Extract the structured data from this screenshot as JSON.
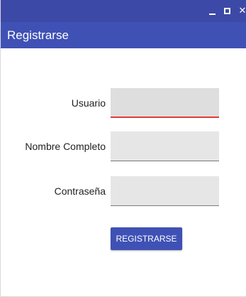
{
  "window": {
    "minimize_icon": "minimize-icon",
    "maximize_icon": "maximize-icon",
    "close_icon": "close-icon",
    "close_glyph": "✕"
  },
  "appbar": {
    "title": "Registrarse"
  },
  "form": {
    "username": {
      "label": "Usuario",
      "value": ""
    },
    "fullname": {
      "label": "Nombre Completo",
      "value": ""
    },
    "password": {
      "label": "Contraseña",
      "value": ""
    },
    "submit_label": "REGISTRARSE"
  },
  "colors": {
    "titlebar": "#3d49a6",
    "appbar": "#3f51b5",
    "accent": "#3f51b5",
    "focus_underline": "#e53935"
  }
}
